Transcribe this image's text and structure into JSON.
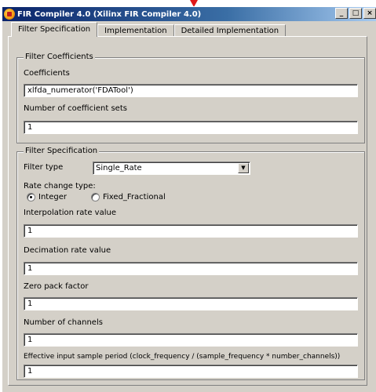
{
  "window": {
    "title": "FIR Compiler 4.0 (Xilinx FIR Compiler 4.0)",
    "min_label": "_",
    "max_label": "□",
    "close_label": "×"
  },
  "tabs": [
    {
      "label": "Filter Specification"
    },
    {
      "label": "Implementation"
    },
    {
      "label": "Detailed Implementation"
    }
  ],
  "filter_coefficients": {
    "legend": "Filter Coefficients",
    "coefficients_label": "Coefficients",
    "coefficients_value": "xlfda_numerator('FDATool')",
    "sets_label": "Number of coefficient sets",
    "sets_value": "1"
  },
  "filter_specification": {
    "legend": "Filter Specification",
    "filter_type_label": "Filter type",
    "filter_type_value": "Single_Rate",
    "rate_change_label": "Rate change type:",
    "rate_options": [
      "Integer",
      "Fixed_Fractional"
    ],
    "rate_selected": "Integer",
    "interp_label": "Interpolation rate value",
    "interp_value": "1",
    "decim_label": "Decimation rate value",
    "decim_value": "1",
    "zero_pack_label": "Zero pack factor",
    "zero_pack_value": "1",
    "channels_label": "Number of channels",
    "channels_value": "1",
    "sample_period_label": "Effective input sample period (clock_frequency / (sample_frequency * number_channels))",
    "sample_period_value": "1"
  }
}
